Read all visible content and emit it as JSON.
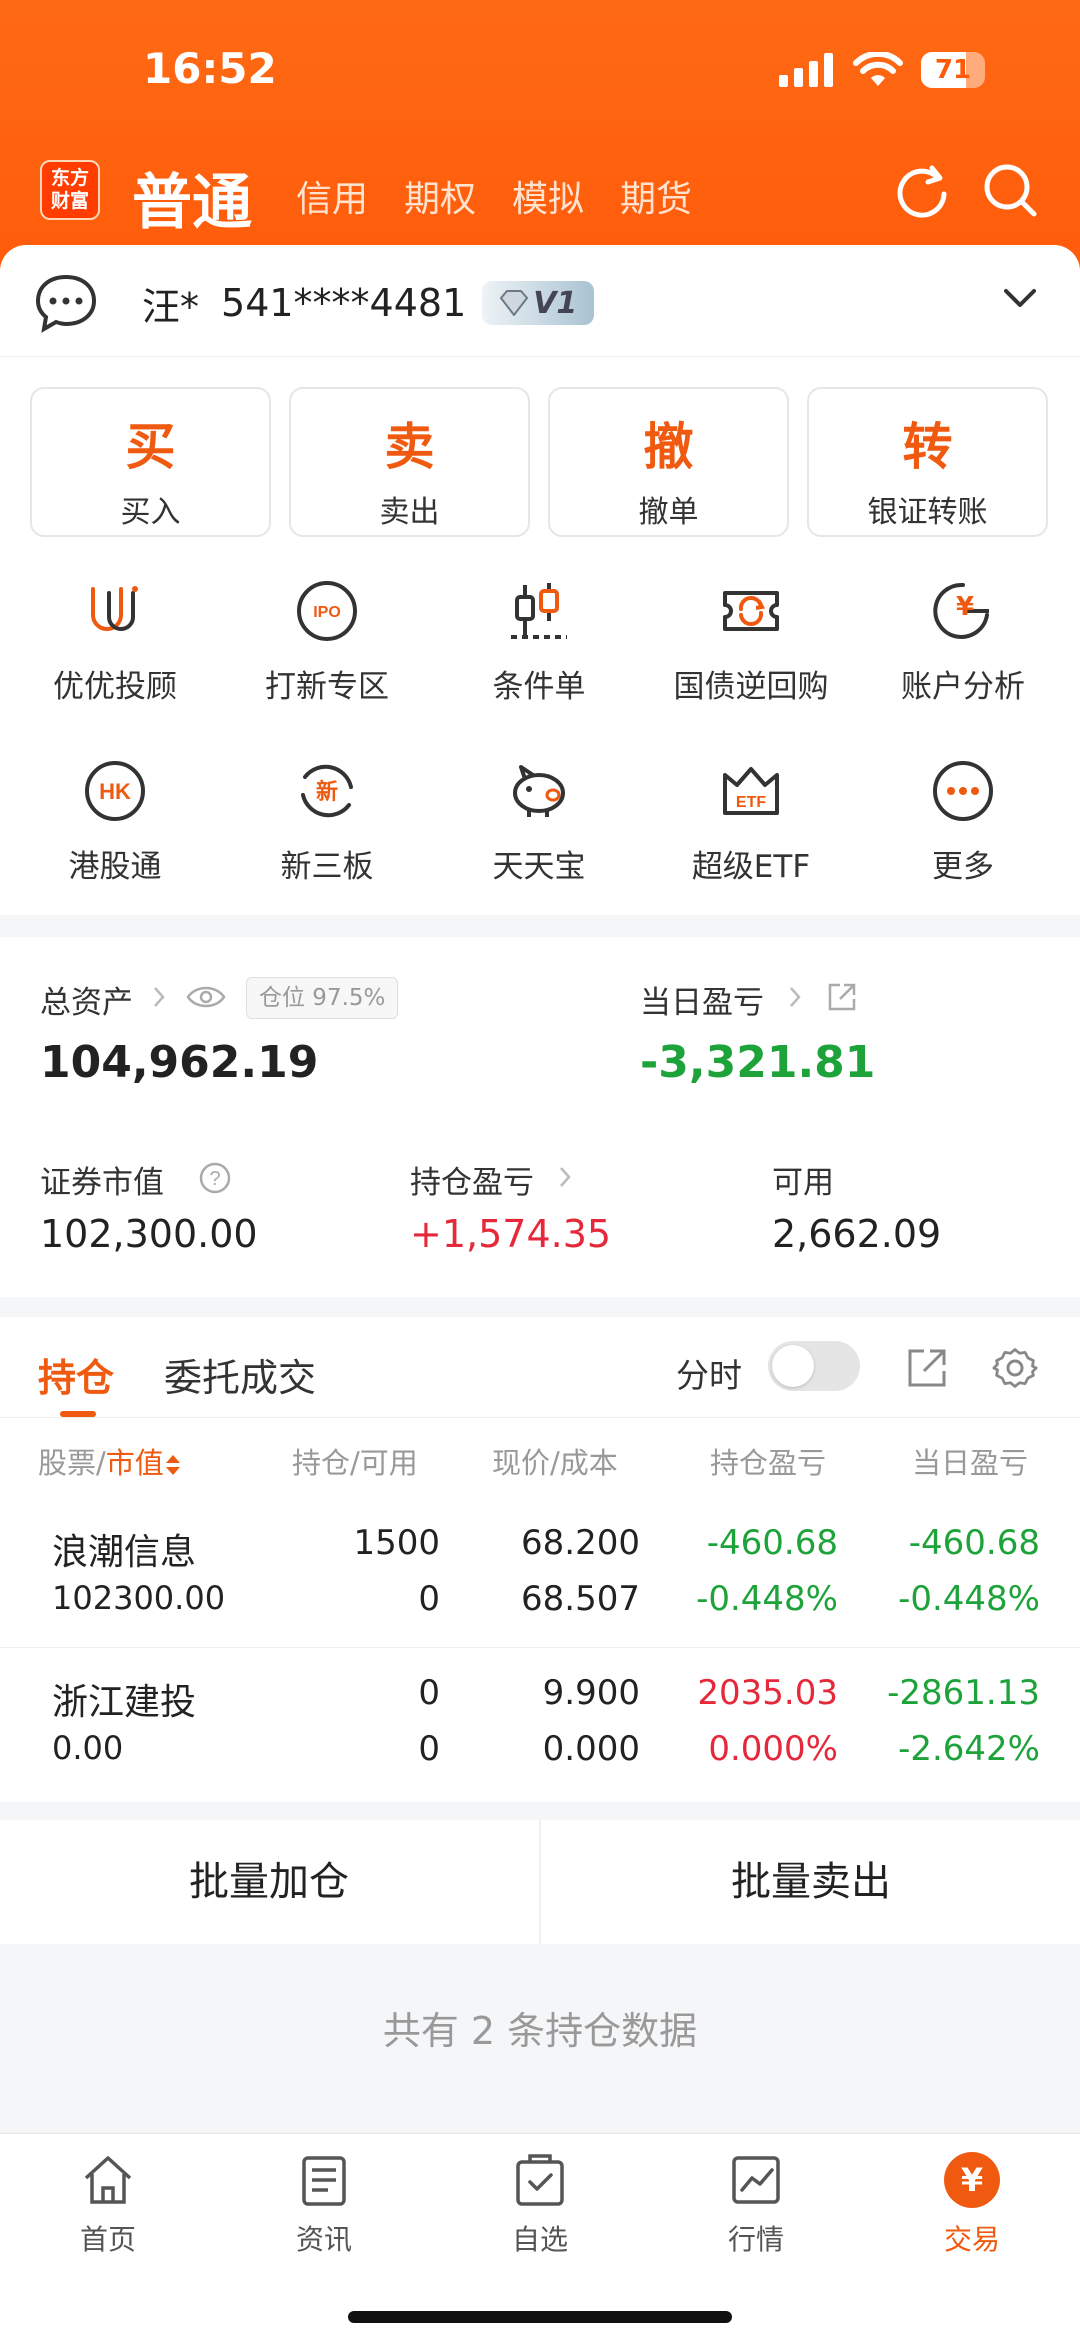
{
  "status_bar": {
    "time": "16:52",
    "battery": "71",
    "battery_level": 0.71
  },
  "header": {
    "logo_text": "东方财富",
    "active_account_type": "普通",
    "account_tabs": [
      "信用",
      "期权",
      "模拟",
      "期货"
    ],
    "refresh_icon": "refresh-icon",
    "search_icon": "search-icon"
  },
  "account": {
    "name": "汪*",
    "number": "541****4481",
    "vip_level": "V1"
  },
  "trade_buttons": [
    {
      "char": "买",
      "label": "买入"
    },
    {
      "char": "卖",
      "label": "卖出"
    },
    {
      "char": "撤",
      "label": "撤单"
    },
    {
      "char": "转",
      "label": "银证转账"
    }
  ],
  "functions": [
    {
      "label": "优优投顾",
      "icon": "advisor-icon"
    },
    {
      "label": "打新专区",
      "icon": "ipo-icon",
      "icon_text": "IPO"
    },
    {
      "label": "条件单",
      "icon": "conditional-order-icon"
    },
    {
      "label": "国债逆回购",
      "icon": "reverse-repo-icon"
    },
    {
      "label": "账户分析",
      "icon": "account-analysis-icon",
      "icon_text": "¥"
    },
    {
      "label": "港股通",
      "icon": "hk-connect-icon",
      "icon_text": "HK"
    },
    {
      "label": "新三板",
      "icon": "neeq-icon",
      "icon_text": "新"
    },
    {
      "label": "天天宝",
      "icon": "piggy-bank-icon"
    },
    {
      "label": "超级ETF",
      "icon": "etf-icon",
      "icon_text": "ETF"
    },
    {
      "label": "更多",
      "icon": "more-icon"
    }
  ],
  "assets": {
    "total_label": "总资产",
    "position_ratio": "仓位 97.5%",
    "total_value": "104,962.19",
    "daily_pnl_label": "当日盈亏",
    "daily_pnl_value": "-3,321.81",
    "market_value_label": "证券市值",
    "market_value": "102,300.00",
    "holding_pnl_label": "持仓盈亏",
    "holding_pnl_value": "+1,574.35",
    "available_label": "可用",
    "available_value": "2,662.09"
  },
  "positions": {
    "tabs": [
      "持仓",
      "委托成交"
    ],
    "intraday_label": "分时",
    "headers": [
      "股票",
      "市值",
      "持仓/可用",
      "现价/成本",
      "持仓盈亏",
      "当日盈亏"
    ],
    "rows": [
      {
        "name": "浪潮信息",
        "market_value": "102300.00",
        "holding": "1500",
        "available": "0",
        "price": "68.200",
        "cost": "68.507",
        "pnl": "-460.68",
        "pnl_pct": "-0.448%",
        "day_pnl": "-460.68",
        "day_pnl_pct": "-0.448%",
        "pnl_color": "#1ea33b",
        "day_color": "#1ea33b"
      },
      {
        "name": "浙江建投",
        "market_value": "0.00",
        "holding": "0",
        "available": "0",
        "price": "9.900",
        "cost": "0.000",
        "pnl": "2035.03",
        "pnl_pct": "0.000%",
        "day_pnl": "-2861.13",
        "day_pnl_pct": "-2.642%",
        "pnl_color": "#e6293a",
        "day_color": "#1ea33b"
      }
    ],
    "batch_add": "批量加仓",
    "batch_sell": "批量卖出",
    "count_text": "共有 2 条持仓数据"
  },
  "bottom_nav": [
    {
      "label": "首页",
      "icon": "home-icon"
    },
    {
      "label": "资讯",
      "icon": "news-icon"
    },
    {
      "label": "自选",
      "icon": "watchlist-icon"
    },
    {
      "label": "行情",
      "icon": "market-icon"
    },
    {
      "label": "交易",
      "icon": "trade-icon",
      "active": true
    }
  ],
  "colors": {
    "brand": "#ef5a10",
    "up": "#e6293a",
    "down": "#1ea33b"
  }
}
